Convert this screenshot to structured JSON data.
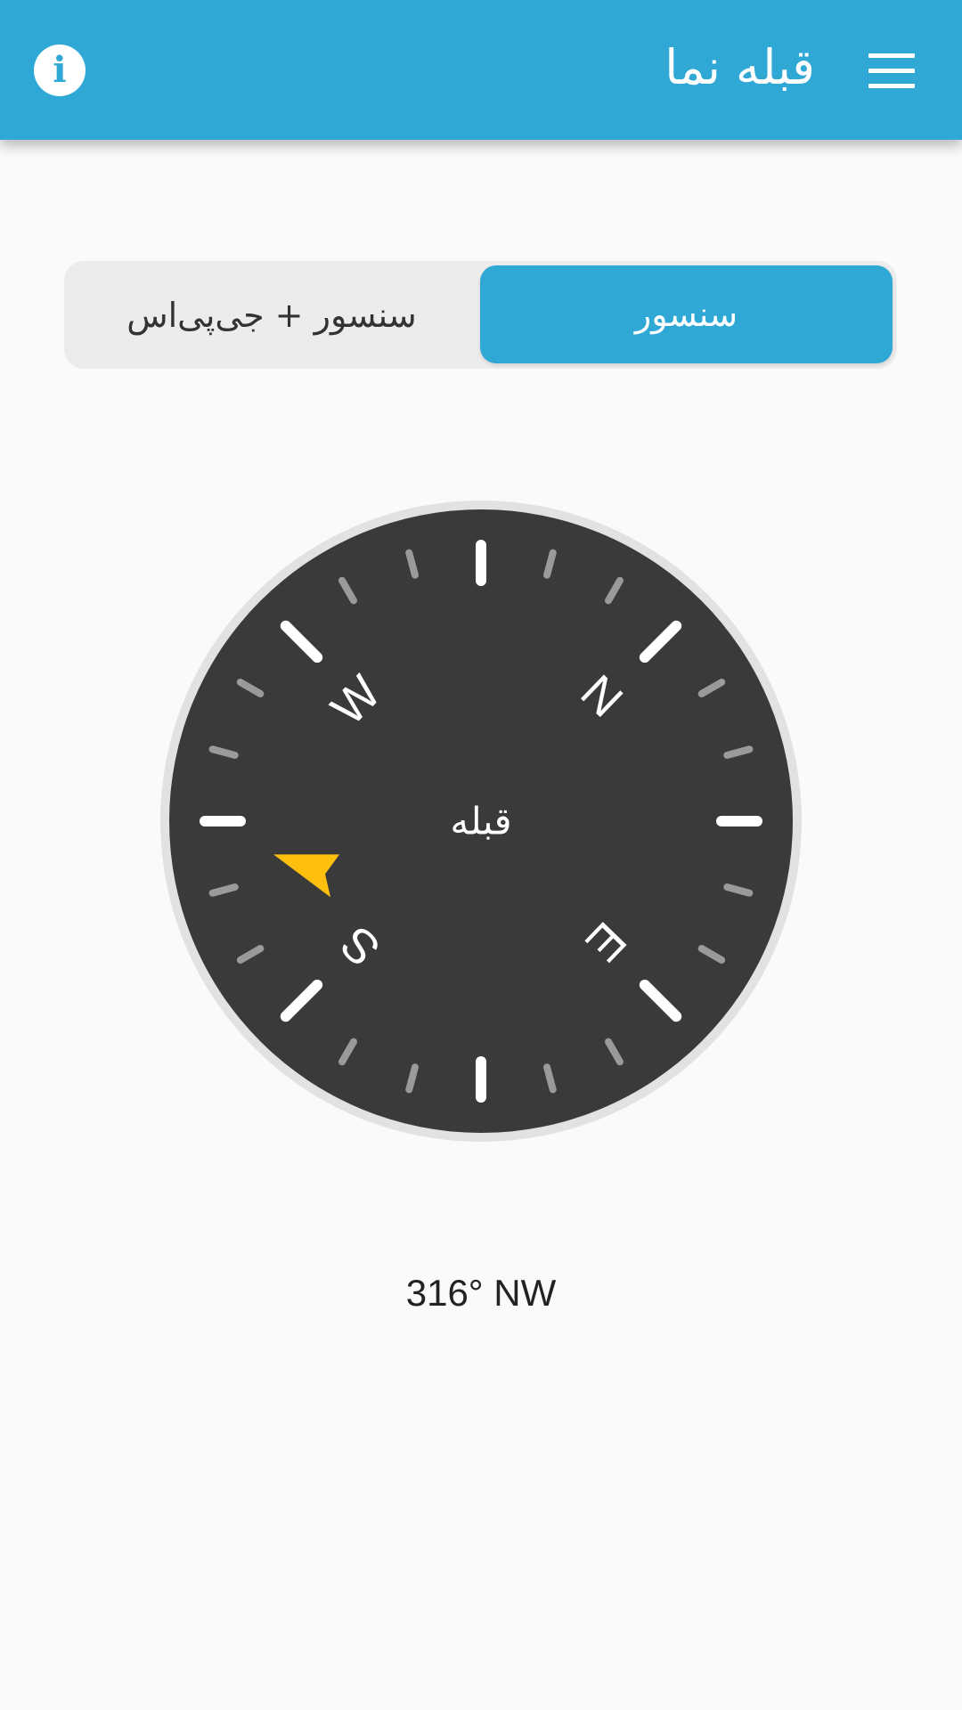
{
  "app_bar": {
    "title": "قبله نما",
    "info_glyph": "i",
    "menu_icon": "hamburger-menu-icon",
    "info_icon": "info-icon",
    "color": "#2fa8d5"
  },
  "mode_selector": {
    "options": [
      {
        "label": "سنسور + جی‌پی‌اس",
        "selected": false
      },
      {
        "label": "سنسور",
        "selected": true
      }
    ]
  },
  "compass": {
    "center_label": "قبله",
    "dial_color": "#3a3a3a",
    "pointer_color": "#ffbf0f",
    "cardinal_labels": [
      "N",
      "E",
      "S",
      "W"
    ],
    "rotation_deg": 44,
    "qibla_bearing_deg": 252
  },
  "heading": {
    "text": "316° NW",
    "degrees": 316,
    "direction": "NW"
  }
}
